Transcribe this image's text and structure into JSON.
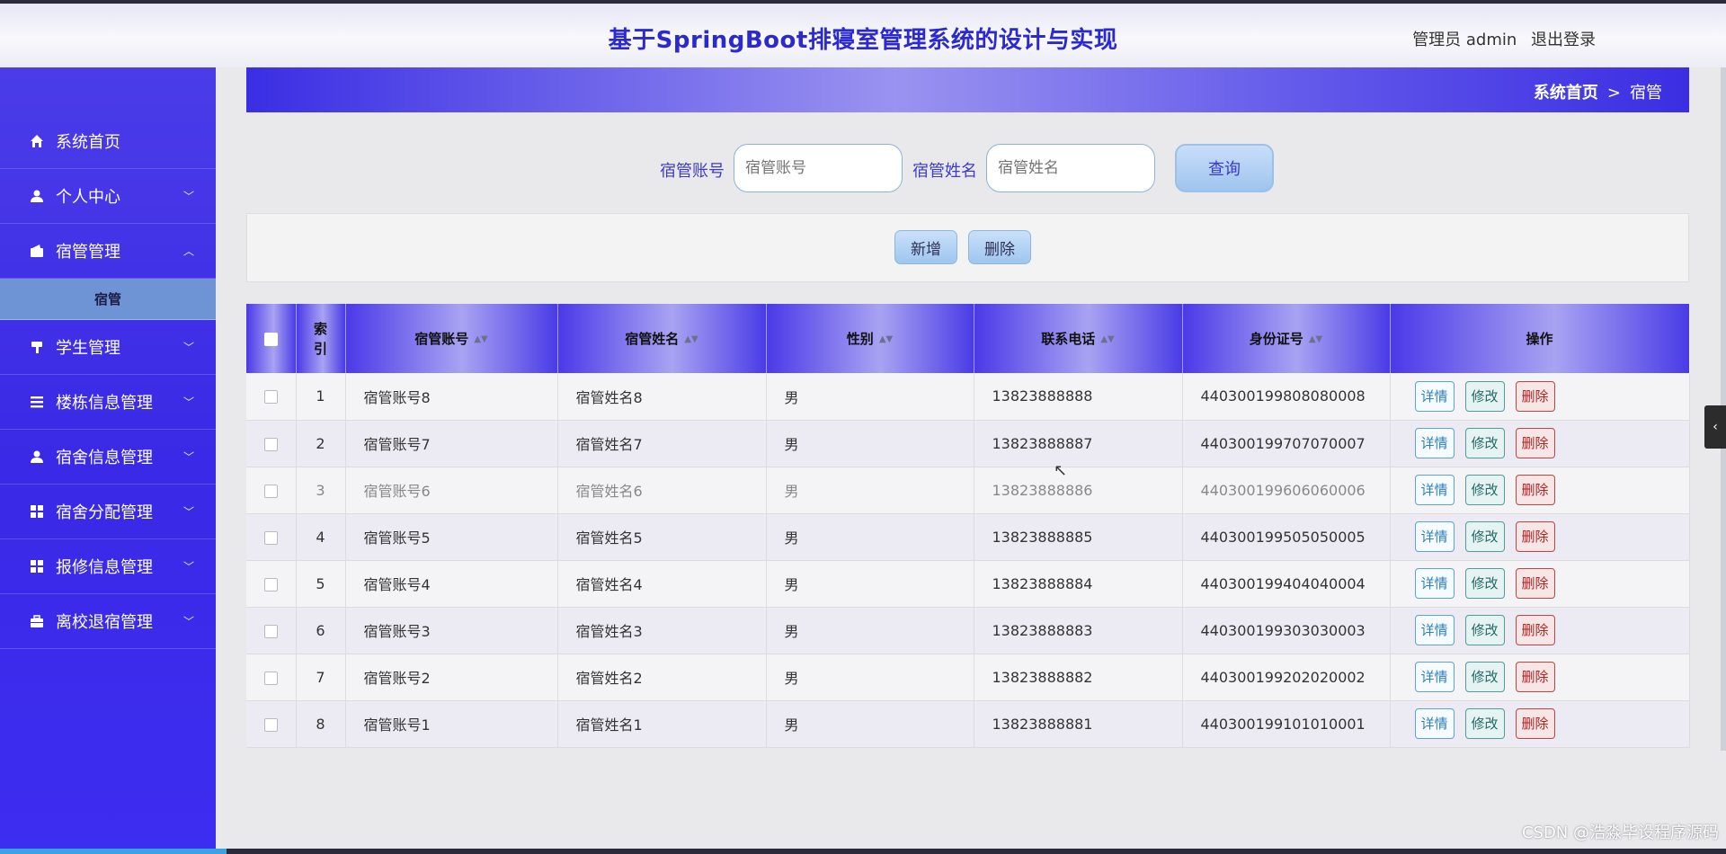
{
  "header": {
    "title": "基于SpringBoot排寝室管理系统的设计与实现",
    "user_label": "管理员 admin",
    "logout_label": "退出登录"
  },
  "sidebar": {
    "items": [
      {
        "label": "系统首页",
        "icon": "home-icon"
      },
      {
        "label": "个人中心",
        "icon": "user-icon",
        "arrow": "chevron-down"
      },
      {
        "label": "宿管管理",
        "icon": "wallet-icon",
        "arrow": "chevron-up",
        "sub": [
          "宿管"
        ]
      },
      {
        "label": "学生管理",
        "icon": "pin-icon",
        "arrow": "chevron-down"
      },
      {
        "label": "楼栋信息管理",
        "icon": "list-icon",
        "arrow": "chevron-down"
      },
      {
        "label": "宿舍信息管理",
        "icon": "user-icon",
        "arrow": "chevron-down"
      },
      {
        "label": "宿舍分配管理",
        "icon": "grid-icon",
        "arrow": "chevron-down"
      },
      {
        "label": "报修信息管理",
        "icon": "grid-icon",
        "arrow": "chevron-down"
      },
      {
        "label": "离校退宿管理",
        "icon": "briefcase-icon",
        "arrow": "chevron-down"
      }
    ]
  },
  "breadcrumb": {
    "home": "系统首页",
    "separator": ">",
    "current": "宿管"
  },
  "search": {
    "account_label": "宿管账号",
    "account_placeholder": "宿管账号",
    "name_label": "宿管姓名",
    "name_placeholder": "宿管姓名",
    "query_button": "查询"
  },
  "toolbar": {
    "add_label": "新增",
    "delete_label": "删除"
  },
  "table": {
    "headers": {
      "index": "索引",
      "account": "宿管账号",
      "name": "宿管姓名",
      "gender": "性别",
      "phone": "联系电话",
      "id_card": "身份证号",
      "actions": "操作"
    },
    "action_labels": {
      "detail": "详情",
      "edit": "修改",
      "delete": "删除"
    },
    "rows": [
      {
        "index": "1",
        "account": "宿管账号8",
        "name": "宿管姓名8",
        "gender": "男",
        "phone": "13823888888",
        "id_card": "440300199808080008"
      },
      {
        "index": "2",
        "account": "宿管账号7",
        "name": "宿管姓名7",
        "gender": "男",
        "phone": "13823888887",
        "id_card": "440300199707070007"
      },
      {
        "index": "3",
        "account": "宿管账号6",
        "name": "宿管姓名6",
        "gender": "男",
        "phone": "13823888886",
        "id_card": "440300199606060006"
      },
      {
        "index": "4",
        "account": "宿管账号5",
        "name": "宿管姓名5",
        "gender": "男",
        "phone": "13823888885",
        "id_card": "440300199505050005"
      },
      {
        "index": "5",
        "account": "宿管账号4",
        "name": "宿管姓名4",
        "gender": "男",
        "phone": "13823888884",
        "id_card": "440300199404040004"
      },
      {
        "index": "6",
        "account": "宿管账号3",
        "name": "宿管姓名3",
        "gender": "男",
        "phone": "13823888883",
        "id_card": "440300199303030003"
      },
      {
        "index": "7",
        "account": "宿管账号2",
        "name": "宿管姓名2",
        "gender": "男",
        "phone": "13823888882",
        "id_card": "440300199202020002"
      },
      {
        "index": "8",
        "account": "宿管账号1",
        "name": "宿管姓名1",
        "gender": "男",
        "phone": "13823888881",
        "id_card": "440300199101010001"
      }
    ]
  },
  "watermark": "CSDN @浩淼毕设程序源码",
  "colors": {
    "primary": "#3a29e6",
    "title": "#2b2ad0",
    "submenu": "#6f94d6"
  }
}
